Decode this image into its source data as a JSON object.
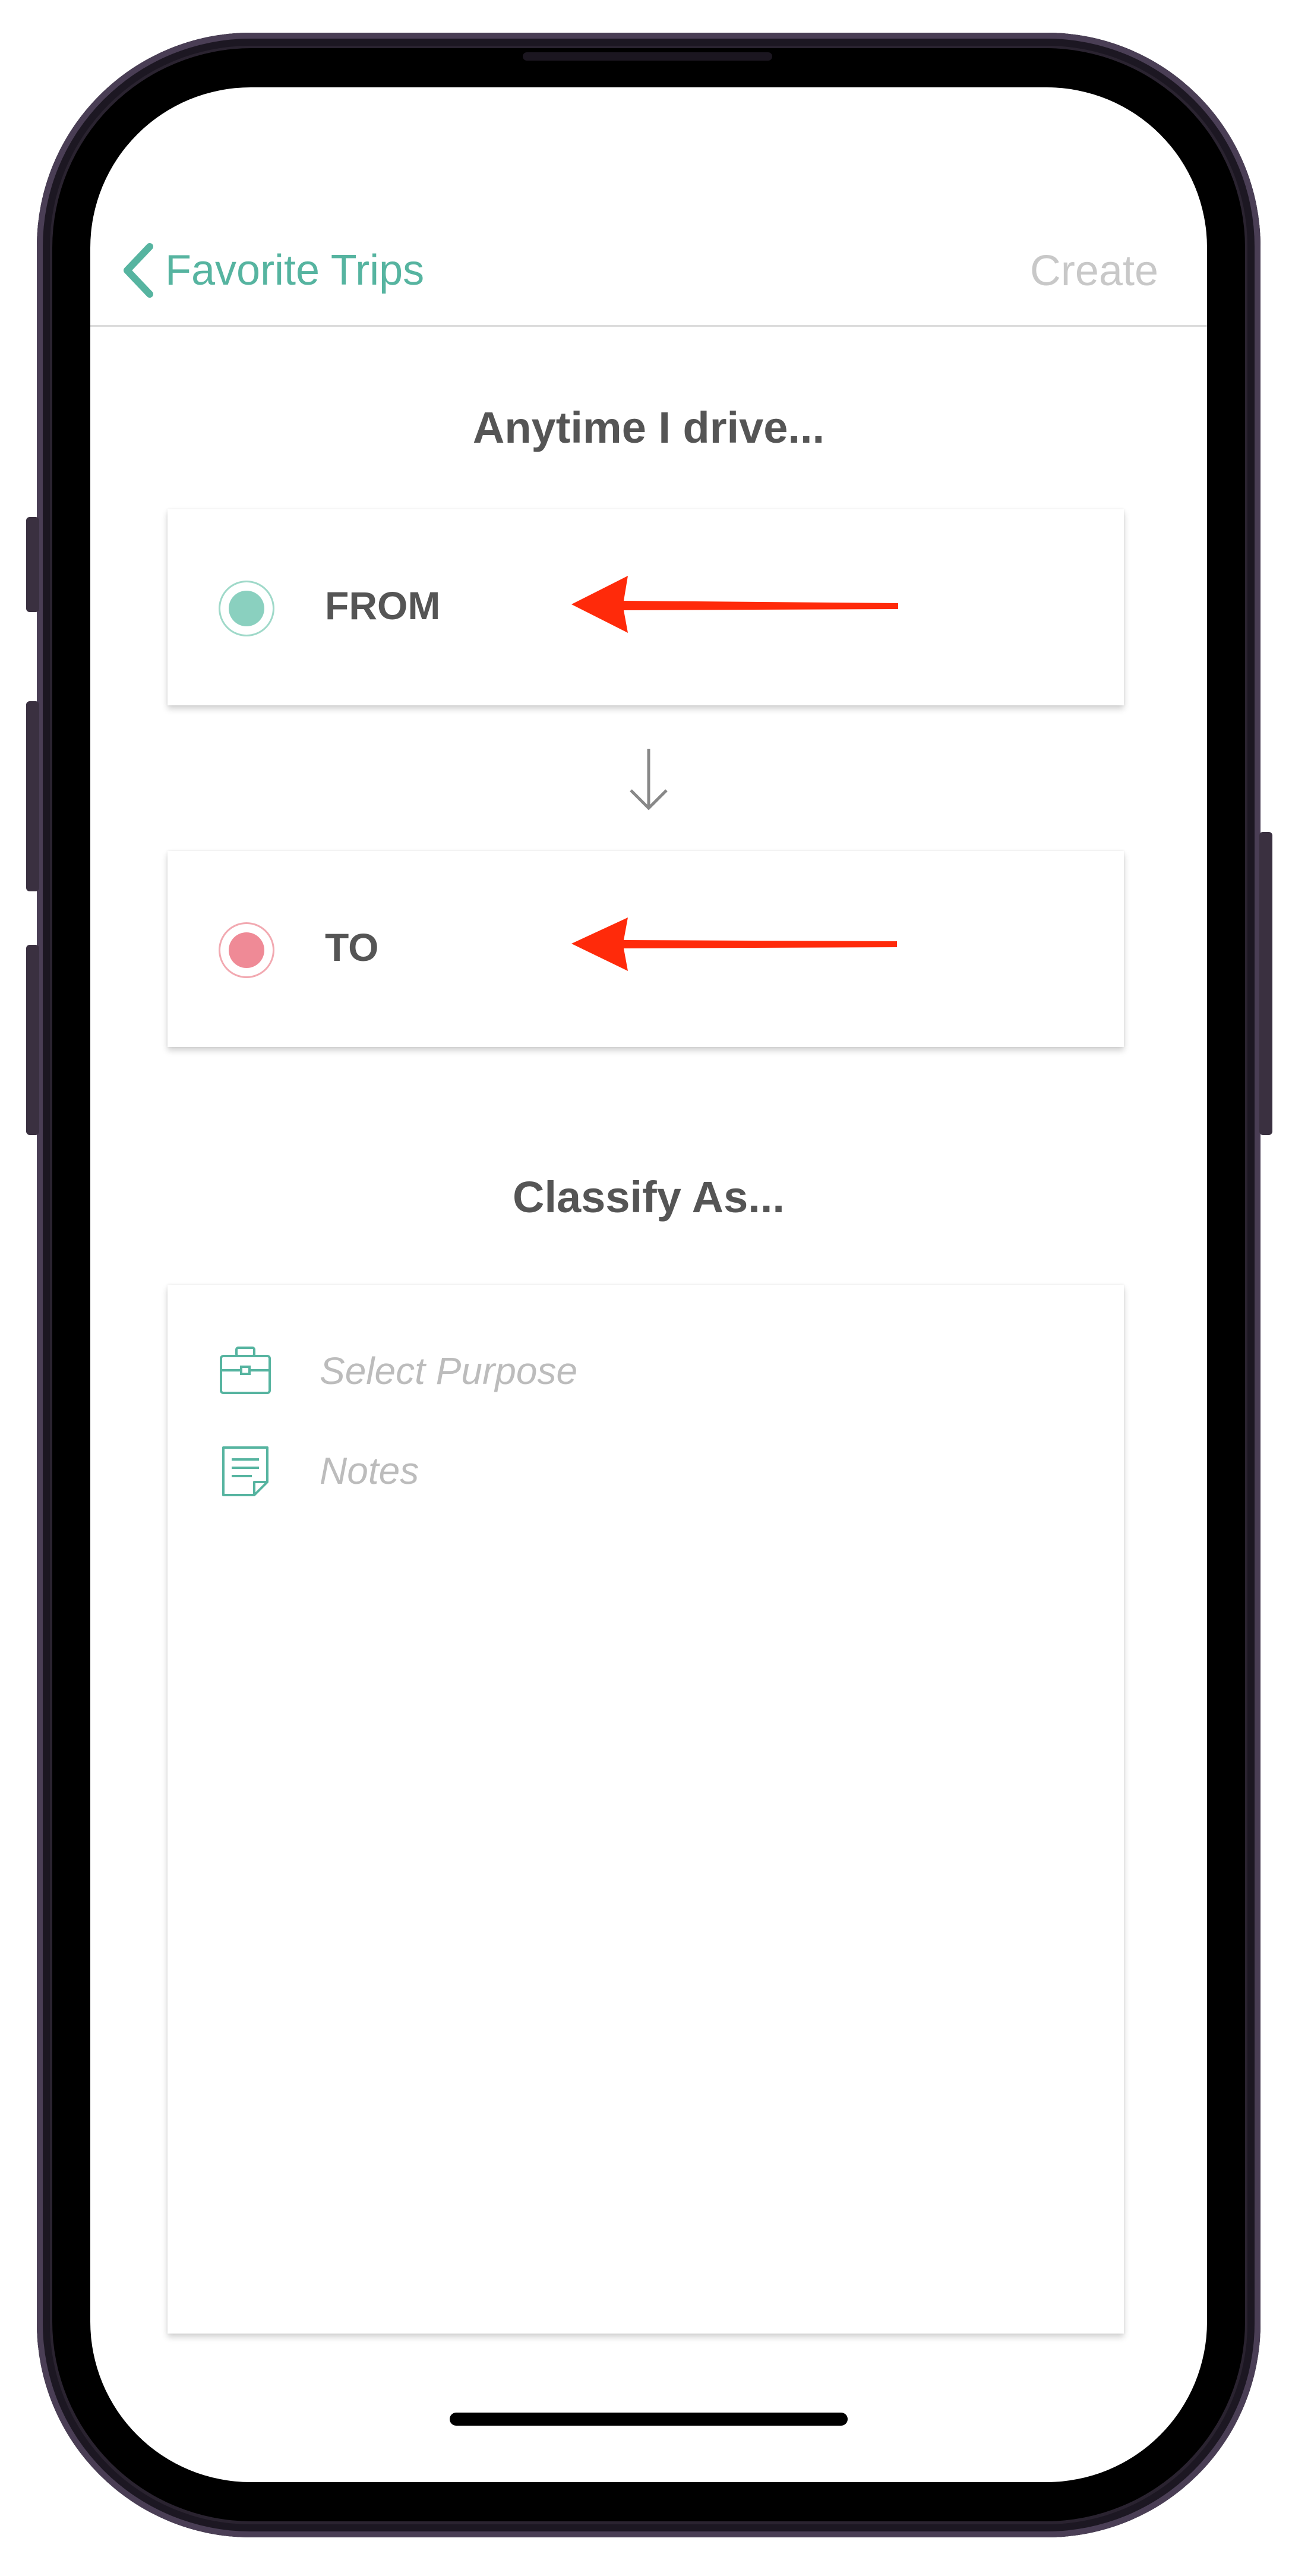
{
  "nav": {
    "back_label": "Favorite Trips",
    "create_label": "Create"
  },
  "route": {
    "heading": "Anytime I drive...",
    "from_label": "FROM",
    "to_label": "TO"
  },
  "classify": {
    "heading": "Classify As...",
    "purpose_placeholder": "Select Purpose",
    "notes_placeholder": "Notes"
  },
  "colors": {
    "accent": "#56b4a0",
    "from_dot": "#8ad0bf",
    "to_dot": "#ef8a96",
    "annotation_arrow": "#ff2a0a"
  },
  "icons": [
    "chevron-left-icon",
    "down-arrow-icon",
    "briefcase-icon",
    "notes-icon"
  ]
}
